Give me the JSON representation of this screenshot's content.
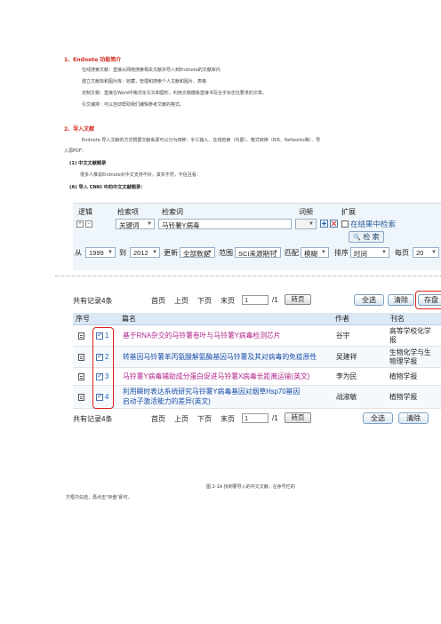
{
  "sections": {
    "s1_title": "1、Endnote 功能简介",
    "s1_lines": [
      "在线搜索文献：直接从网络搜索相关文献并导入到Endnote的文献库内",
      "建立文献库和图片库：收藏，管理和搜索个人文献和图片、表格",
      "定制文稿：直接在Word中格式化引文和图形，利用文稿模板直接书写合乎杂志社要求的文章。",
      "引文编排：可以自动帮助我们编辑参考文献的格式。"
    ],
    "s2_title": "2、导入文献",
    "s2_line1": "Endnote 导入文献的方式根据文献来源可以分为四种：手工输入、在线检索（内置）、格式转换（RIS、Refworks等）、导",
    "s2_line2": "入源PDF：",
    "sub1": "(1) 中文文献题录",
    "sub1_line": "很多人推说Endnote对中文支持不好，其实不然，不信且看：",
    "sub2": "(A) 导入 CNKI 中的中文文献题录："
  },
  "search": {
    "col_logic": "逻辑",
    "col_field": "检索项",
    "col_term": "检索词",
    "col_freq": "词频",
    "col_ext": "扩展",
    "field_value": "关键词",
    "term_value": "马铃薯Y病毒",
    "in_results_label": "在结果中检索",
    "search_btn": "检 索",
    "from_label": "从",
    "year_from": "1999",
    "to_label": "到",
    "year_to": "2012",
    "update_label": "更新",
    "update_value": "全部数据",
    "scope_label": "范围",
    "scope_value": "SCI来源期刊",
    "match_label": "匹配",
    "match_value": "模糊",
    "sort_label": "排序",
    "sort_value": "时间",
    "perpage_label": "每页",
    "perpage_value": "20"
  },
  "pager": {
    "total": "共有记录4条",
    "first": "首页",
    "prev": "上页",
    "next": "下页",
    "last": "末页",
    "page_value": "1",
    "page_total": "/1",
    "go_btn": "转页",
    "select_all": "全选",
    "clear": "清除",
    "save": "存盘"
  },
  "table": {
    "headers": [
      "序号",
      "篇名",
      "作者",
      "刊名"
    ],
    "rows": [
      {
        "num": "1",
        "title": "基于RNA杂交的马铃薯卷叶与马铃薯Y病毒检测芯片",
        "author": "谷宇",
        "journal1": "高等学校化学",
        "journal2": "报"
      },
      {
        "num": "2",
        "title": "转基因马铃薯苯丙氨酸解氨酶基因马铃薯及其对病毒的免疫原性",
        "author": "吴建祥",
        "journal1": "生物化学与生",
        "journal2": "物理学报"
      },
      {
        "num": "3",
        "title": "马铃薯Y病毒辅助成分蛋白促进马铃薯X病毒长距离运输(英文)",
        "author": "李为民",
        "journal1": "植物学报",
        "journal2": ""
      },
      {
        "num": "4",
        "title": "利用瞬时表达系统研究马铃薯Y病毒基因对烟草Hsp70基因",
        "title2": "启动子激活能力的差异(英文)",
        "author": "战淑敏",
        "journal1": "植物学报",
        "journal2": ""
      }
    ]
  },
  "caption": {
    "line1": "图 2-1A 找到要导入的中文文献，在序号栏的",
    "line2": "方框内勾选，再点击\"存盘\"即可。"
  }
}
